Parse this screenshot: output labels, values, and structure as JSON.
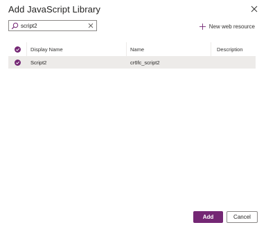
{
  "dialog": {
    "title": "Add JavaScript Library"
  },
  "search": {
    "value": "script2",
    "icon": "search-icon",
    "clear_icon": "close-icon"
  },
  "toolbar": {
    "new_resource_label": "New web resource",
    "new_resource_icon": "plus-icon"
  },
  "grid": {
    "columns": {
      "display_name": "Display Name",
      "name": "Name",
      "description": "Description"
    },
    "rows": [
      {
        "selected": true,
        "display_name": "Script2",
        "name": "cr6fc_script2",
        "description": ""
      }
    ]
  },
  "footer": {
    "add_label": "Add",
    "cancel_label": "Cancel"
  },
  "colors": {
    "accent": "#742774",
    "row_selected_bg": "#edebe9",
    "border": "#8a8886"
  }
}
